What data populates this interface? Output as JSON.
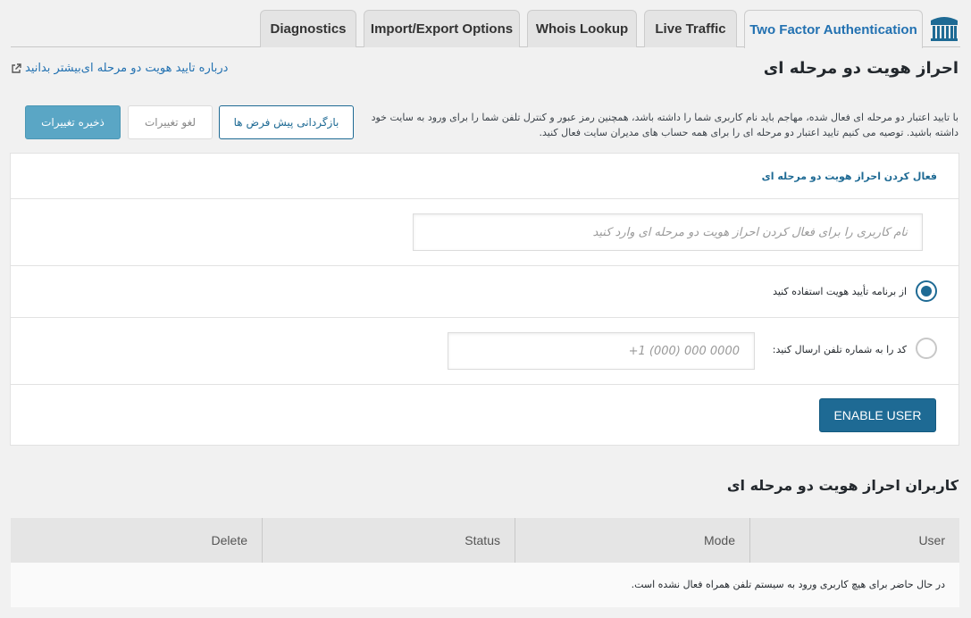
{
  "tabs": [
    {
      "label": "Diagnostics"
    },
    {
      "label": "Import/Export Options"
    },
    {
      "label": "Whois Lookup"
    },
    {
      "label": "Live Traffic"
    },
    {
      "label": "Two Factor Authentication"
    }
  ],
  "header": {
    "title": "احراز هویت دو مرحله ای",
    "help_link": "درباره تایید هویت دو مرحله ای‌بیشتر بدانید"
  },
  "toolbar": {
    "save_label": "ذخیره تغییرات",
    "cancel_label": "لغو تغییرات",
    "reset_label": "بازگردانی پیش فرض ها"
  },
  "intro": "با تایید اعتبار دو مرحله ای فعال شده، مهاجم باید نام کاربری شما را داشته باشد، همچنین رمز عبور و کنترل تلفن شما را برای ورود به سایت خود داشته باشید. توصیه می کنیم تایید اعتبار دو مرحله ای را برای همه حساب های مدیران سایت فعال کنید.",
  "panel": {
    "title": "فعال کردن احراز هویت دو مرحله ای",
    "username_placeholder": "نام کاربری را برای فعال کردن احراز هویت دو مرحله ای وارد کنید",
    "option_app": "از برنامه تأیید هویت استفاده کنید",
    "option_sms": "کد را به شماره تلفن ارسال کنید:",
    "phone_placeholder": "+1 (000) 000 0000",
    "enable_button": "ENABLE USER"
  },
  "users": {
    "title": "کاربران احراز هویت دو مرحله ای",
    "columns": [
      "Delete",
      "Status",
      "Mode",
      "User"
    ],
    "empty_message": "در حال حاضر برای هیچ کاربری ورود به سیستم تلفن همراه فعال نشده است."
  },
  "colors": {
    "accent": "#1e6a94",
    "save_button": "#5aa6c5",
    "background": "#f1f1f1"
  }
}
